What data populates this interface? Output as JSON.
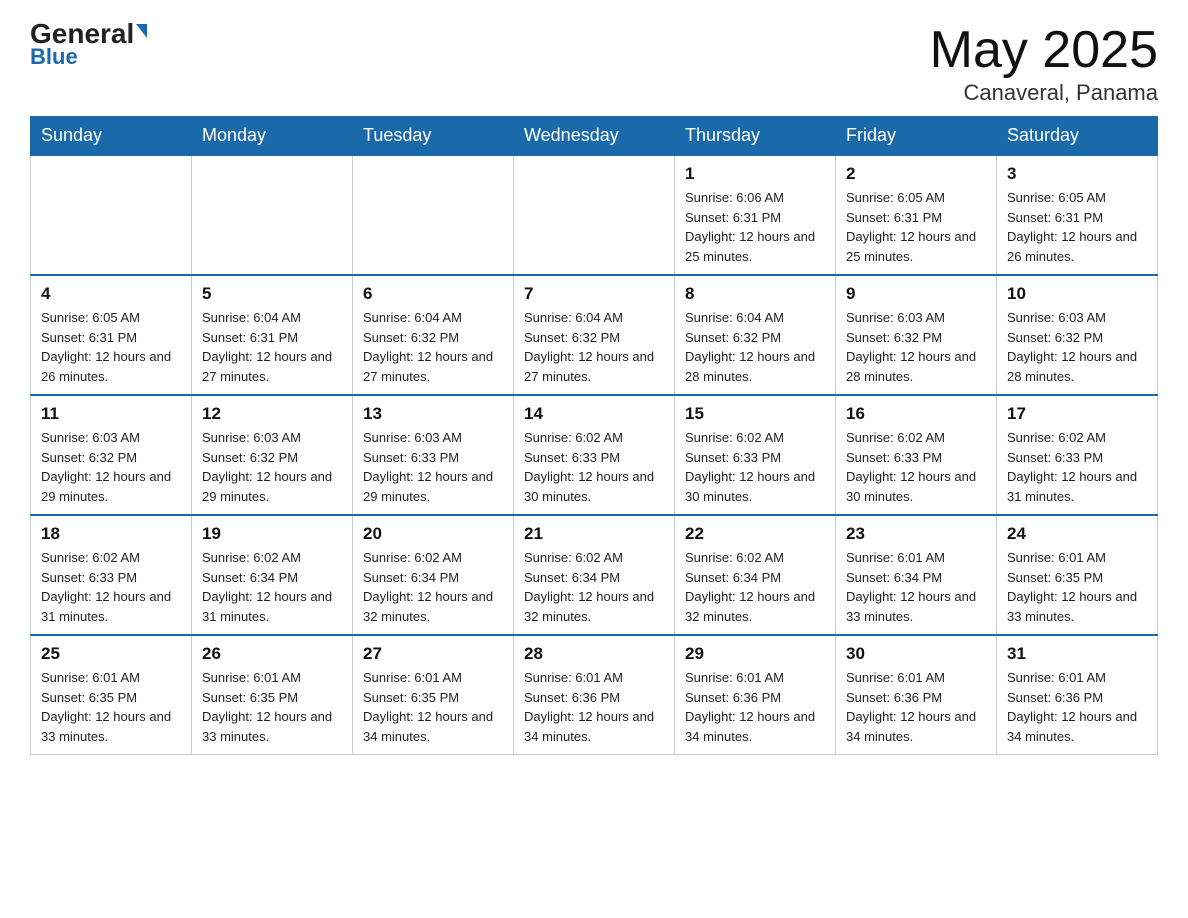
{
  "header": {
    "logo_general": "General",
    "logo_blue": "Blue",
    "title": "May 2025",
    "subtitle": "Canaveral, Panama"
  },
  "weekdays": [
    "Sunday",
    "Monday",
    "Tuesday",
    "Wednesday",
    "Thursday",
    "Friday",
    "Saturday"
  ],
  "weeks": [
    [
      {
        "day": "",
        "sunrise": "",
        "sunset": "",
        "daylight": ""
      },
      {
        "day": "",
        "sunrise": "",
        "sunset": "",
        "daylight": ""
      },
      {
        "day": "",
        "sunrise": "",
        "sunset": "",
        "daylight": ""
      },
      {
        "day": "",
        "sunrise": "",
        "sunset": "",
        "daylight": ""
      },
      {
        "day": "1",
        "sunrise": "Sunrise: 6:06 AM",
        "sunset": "Sunset: 6:31 PM",
        "daylight": "Daylight: 12 hours and 25 minutes."
      },
      {
        "day": "2",
        "sunrise": "Sunrise: 6:05 AM",
        "sunset": "Sunset: 6:31 PM",
        "daylight": "Daylight: 12 hours and 25 minutes."
      },
      {
        "day": "3",
        "sunrise": "Sunrise: 6:05 AM",
        "sunset": "Sunset: 6:31 PM",
        "daylight": "Daylight: 12 hours and 26 minutes."
      }
    ],
    [
      {
        "day": "4",
        "sunrise": "Sunrise: 6:05 AM",
        "sunset": "Sunset: 6:31 PM",
        "daylight": "Daylight: 12 hours and 26 minutes."
      },
      {
        "day": "5",
        "sunrise": "Sunrise: 6:04 AM",
        "sunset": "Sunset: 6:31 PM",
        "daylight": "Daylight: 12 hours and 27 minutes."
      },
      {
        "day": "6",
        "sunrise": "Sunrise: 6:04 AM",
        "sunset": "Sunset: 6:32 PM",
        "daylight": "Daylight: 12 hours and 27 minutes."
      },
      {
        "day": "7",
        "sunrise": "Sunrise: 6:04 AM",
        "sunset": "Sunset: 6:32 PM",
        "daylight": "Daylight: 12 hours and 27 minutes."
      },
      {
        "day": "8",
        "sunrise": "Sunrise: 6:04 AM",
        "sunset": "Sunset: 6:32 PM",
        "daylight": "Daylight: 12 hours and 28 minutes."
      },
      {
        "day": "9",
        "sunrise": "Sunrise: 6:03 AM",
        "sunset": "Sunset: 6:32 PM",
        "daylight": "Daylight: 12 hours and 28 minutes."
      },
      {
        "day": "10",
        "sunrise": "Sunrise: 6:03 AM",
        "sunset": "Sunset: 6:32 PM",
        "daylight": "Daylight: 12 hours and 28 minutes."
      }
    ],
    [
      {
        "day": "11",
        "sunrise": "Sunrise: 6:03 AM",
        "sunset": "Sunset: 6:32 PM",
        "daylight": "Daylight: 12 hours and 29 minutes."
      },
      {
        "day": "12",
        "sunrise": "Sunrise: 6:03 AM",
        "sunset": "Sunset: 6:32 PM",
        "daylight": "Daylight: 12 hours and 29 minutes."
      },
      {
        "day": "13",
        "sunrise": "Sunrise: 6:03 AM",
        "sunset": "Sunset: 6:33 PM",
        "daylight": "Daylight: 12 hours and 29 minutes."
      },
      {
        "day": "14",
        "sunrise": "Sunrise: 6:02 AM",
        "sunset": "Sunset: 6:33 PM",
        "daylight": "Daylight: 12 hours and 30 minutes."
      },
      {
        "day": "15",
        "sunrise": "Sunrise: 6:02 AM",
        "sunset": "Sunset: 6:33 PM",
        "daylight": "Daylight: 12 hours and 30 minutes."
      },
      {
        "day": "16",
        "sunrise": "Sunrise: 6:02 AM",
        "sunset": "Sunset: 6:33 PM",
        "daylight": "Daylight: 12 hours and 30 minutes."
      },
      {
        "day": "17",
        "sunrise": "Sunrise: 6:02 AM",
        "sunset": "Sunset: 6:33 PM",
        "daylight": "Daylight: 12 hours and 31 minutes."
      }
    ],
    [
      {
        "day": "18",
        "sunrise": "Sunrise: 6:02 AM",
        "sunset": "Sunset: 6:33 PM",
        "daylight": "Daylight: 12 hours and 31 minutes."
      },
      {
        "day": "19",
        "sunrise": "Sunrise: 6:02 AM",
        "sunset": "Sunset: 6:34 PM",
        "daylight": "Daylight: 12 hours and 31 minutes."
      },
      {
        "day": "20",
        "sunrise": "Sunrise: 6:02 AM",
        "sunset": "Sunset: 6:34 PM",
        "daylight": "Daylight: 12 hours and 32 minutes."
      },
      {
        "day": "21",
        "sunrise": "Sunrise: 6:02 AM",
        "sunset": "Sunset: 6:34 PM",
        "daylight": "Daylight: 12 hours and 32 minutes."
      },
      {
        "day": "22",
        "sunrise": "Sunrise: 6:02 AM",
        "sunset": "Sunset: 6:34 PM",
        "daylight": "Daylight: 12 hours and 32 minutes."
      },
      {
        "day": "23",
        "sunrise": "Sunrise: 6:01 AM",
        "sunset": "Sunset: 6:34 PM",
        "daylight": "Daylight: 12 hours and 33 minutes."
      },
      {
        "day": "24",
        "sunrise": "Sunrise: 6:01 AM",
        "sunset": "Sunset: 6:35 PM",
        "daylight": "Daylight: 12 hours and 33 minutes."
      }
    ],
    [
      {
        "day": "25",
        "sunrise": "Sunrise: 6:01 AM",
        "sunset": "Sunset: 6:35 PM",
        "daylight": "Daylight: 12 hours and 33 minutes."
      },
      {
        "day": "26",
        "sunrise": "Sunrise: 6:01 AM",
        "sunset": "Sunset: 6:35 PM",
        "daylight": "Daylight: 12 hours and 33 minutes."
      },
      {
        "day": "27",
        "sunrise": "Sunrise: 6:01 AM",
        "sunset": "Sunset: 6:35 PM",
        "daylight": "Daylight: 12 hours and 34 minutes."
      },
      {
        "day": "28",
        "sunrise": "Sunrise: 6:01 AM",
        "sunset": "Sunset: 6:36 PM",
        "daylight": "Daylight: 12 hours and 34 minutes."
      },
      {
        "day": "29",
        "sunrise": "Sunrise: 6:01 AM",
        "sunset": "Sunset: 6:36 PM",
        "daylight": "Daylight: 12 hours and 34 minutes."
      },
      {
        "day": "30",
        "sunrise": "Sunrise: 6:01 AM",
        "sunset": "Sunset: 6:36 PM",
        "daylight": "Daylight: 12 hours and 34 minutes."
      },
      {
        "day": "31",
        "sunrise": "Sunrise: 6:01 AM",
        "sunset": "Sunset: 6:36 PM",
        "daylight": "Daylight: 12 hours and 34 minutes."
      }
    ]
  ]
}
